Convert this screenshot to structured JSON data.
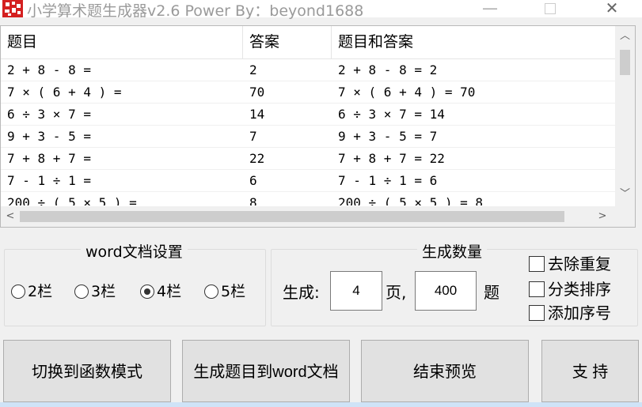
{
  "window": {
    "title": "小学算术题生成器v2.6  Power By：beyond1688",
    "minimize_glyph": "—",
    "close_glyph": "✕"
  },
  "list": {
    "columns": [
      "题目",
      "答案",
      "题目和答案"
    ],
    "rows": [
      [
        "2 + 8 - 8 =",
        "2",
        "2 + 8 - 8 = 2"
      ],
      [
        "7 × ( 6 + 4 ) =",
        "70",
        "7 × ( 6 + 4 ) = 70"
      ],
      [
        "6 ÷ 3 × 7 =",
        "14",
        "6 ÷ 3 × 7 = 14"
      ],
      [
        "9 + 3 - 5 =",
        "7",
        "9 + 3 - 5 = 7"
      ],
      [
        "7 + 8 + 7 =",
        "22",
        "7 + 8 + 7 = 22"
      ],
      [
        "7 - 1 ÷ 1 =",
        "6",
        "7 - 1 ÷ 1 = 6"
      ],
      [
        "200 ÷ ( 5 × 5 ) =",
        "8",
        "200 ÷ ( 5 × 5 ) = 8"
      ]
    ],
    "scroll_up_glyph": "︿",
    "scroll_down_glyph": "﹀",
    "scroll_left_glyph": "<",
    "scroll_right_glyph": ">"
  },
  "word_settings": {
    "title": "word文档设置",
    "options": [
      "2栏",
      "3栏",
      "4栏",
      "5栏"
    ],
    "selected": "4栏"
  },
  "quantity": {
    "title": "生成数量",
    "generate_label": "生成:",
    "pages_value": "4",
    "pages_unit": "页,",
    "count_value": "400",
    "count_unit": "题"
  },
  "options": {
    "dedupe": "去除重复",
    "sort_by_category": "分类排序",
    "add_serial": "添加序号"
  },
  "buttons": {
    "switch_mode": "切换到函数模式",
    "generate_word": "生成题目到word文档",
    "end_preview": "结束预览",
    "support": "支 持"
  },
  "colors": {
    "icon_red": "#d42020",
    "title_gray": "#9a9a9a",
    "button_face": "#e1e1e1"
  }
}
